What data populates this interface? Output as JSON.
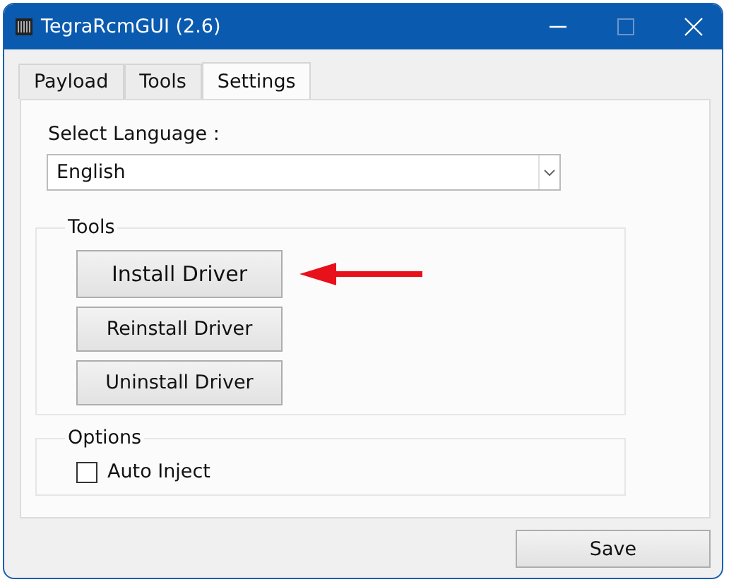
{
  "window": {
    "title": "TegraRcmGUI (2.6)"
  },
  "tabs": [
    {
      "label": "Payload",
      "selected": false
    },
    {
      "label": "Tools",
      "selected": false
    },
    {
      "label": "Settings",
      "selected": true
    }
  ],
  "language": {
    "label": "Select Language :",
    "value": "English"
  },
  "tools_group": {
    "title": "Tools",
    "buttons": [
      {
        "label": "Install Driver",
        "kind": "large",
        "highlighted": true
      },
      {
        "label": "Reinstall Driver",
        "kind": "normal",
        "highlighted": false
      },
      {
        "label": "Uninstall Driver",
        "kind": "normal",
        "highlighted": false
      }
    ]
  },
  "options_group": {
    "title": "Options",
    "checkboxes": [
      {
        "label": "Auto Inject",
        "checked": false
      }
    ]
  },
  "save_button": {
    "label": "Save"
  }
}
